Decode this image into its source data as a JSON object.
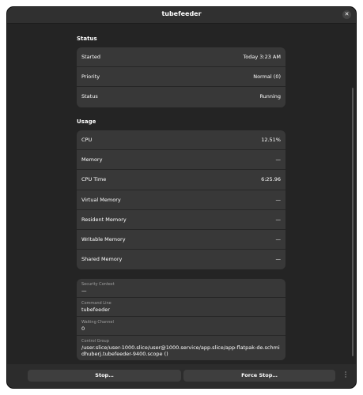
{
  "window": {
    "title": "tubefeeder"
  },
  "status_section": {
    "title": "Status",
    "rows": [
      {
        "label": "Started",
        "value": "Today  3:23 AM"
      },
      {
        "label": "Priority",
        "value": "Normal (0)"
      },
      {
        "label": "Status",
        "value": "Running"
      }
    ]
  },
  "usage_section": {
    "title": "Usage",
    "rows": [
      {
        "label": "CPU",
        "value": "12.51%"
      },
      {
        "label": "Memory",
        "value": "—"
      },
      {
        "label": "CPU Time",
        "value": "6:25.96"
      },
      {
        "label": "Virtual Memory",
        "value": "—"
      },
      {
        "label": "Resident Memory",
        "value": "—"
      },
      {
        "label": "Writable Memory",
        "value": "—"
      },
      {
        "label": "Shared Memory",
        "value": "—"
      }
    ]
  },
  "info_section": {
    "rows": [
      {
        "label": "Security Context",
        "value": "—"
      },
      {
        "label": "Command Line",
        "value": "tubefeeder"
      },
      {
        "label": "Waiting Channel",
        "value": "0"
      },
      {
        "label": "Control Group",
        "value": "/user.slice/user-1000.slice/user@1000.service/app.slice/app-flatpak-de.schmidhuberj.tubefeeder-9400.scope ()"
      }
    ]
  },
  "footer": {
    "stop_label": "Stop…",
    "force_stop_label": "Force Stop…",
    "menu_icon": "vertical-ellipsis-icon"
  }
}
